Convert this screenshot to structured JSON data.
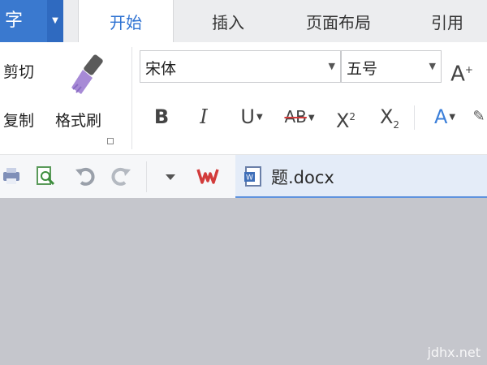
{
  "app_menu": {
    "label": "字"
  },
  "tabs": [
    {
      "label": "开始",
      "active": true
    },
    {
      "label": "插入",
      "active": false
    },
    {
      "label": "页面布局",
      "active": false
    },
    {
      "label": "引用",
      "active": false
    }
  ],
  "clipboard": {
    "cut_label": "剪切",
    "copy_label": "复制",
    "format_painter_label": "格式刷"
  },
  "font": {
    "name": "宋体",
    "size": "五号",
    "grow_label": "A",
    "grow_sup": "+"
  },
  "format_buttons": {
    "bold": "B",
    "italic": "I",
    "underline": "U",
    "strikethrough": "AB",
    "superscript": "X",
    "superscript_mark": "2",
    "subscript": "X",
    "subscript_mark": "2",
    "text_effect": "A"
  },
  "quick_access": {
    "icons": [
      "print-icon",
      "print-preview-icon",
      "undo-icon",
      "redo-icon",
      "customize-dropdown-icon",
      "wps-logo-icon"
    ]
  },
  "document": {
    "tab_name": "题.docx",
    "icon": "word-document-icon"
  },
  "watermark": "jdhx.net",
  "colors": {
    "accent_blue": "#2e72d2",
    "app_menu_bg": "#3a79cf",
    "wps_red": "#d23b3b",
    "doc_area_bg": "#c5c6cc",
    "format_painter_purple": "#a78ad6"
  }
}
